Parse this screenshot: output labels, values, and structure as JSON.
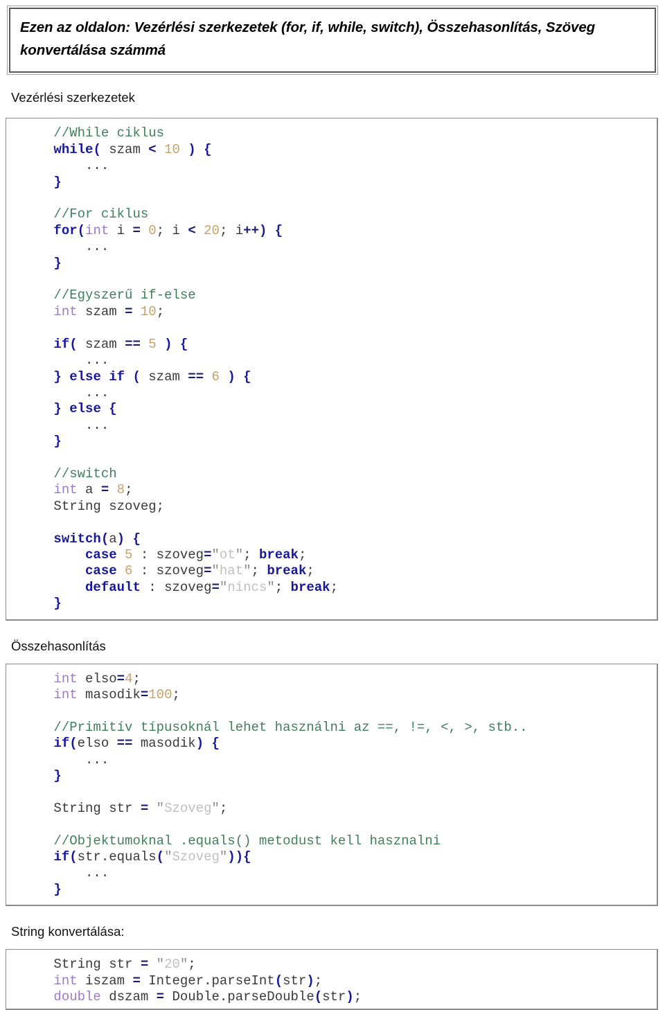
{
  "document": {
    "header_box": {
      "text": "Ezen az oldalon: Vezérlési szerkezetek (for, if, while, switch), Összehasonlítás, Szöveg konvertálása számmá"
    },
    "sections": [
      {
        "heading": "Vezérlési szerkezetek",
        "code_lines": [
          "//While ciklus",
          "while( szam < 10 ) {",
          "    ...",
          "}",
          "",
          "//For ciklus",
          "for(int i = 0; i < 20; i++) {",
          "    ...",
          "}",
          "",
          "//Egyszerű if-else",
          "int szam = 10;",
          "",
          "if( szam == 5 ) {",
          "    ...",
          "} else if ( szam == 6 ) {",
          "    ...",
          "} else {",
          "    ...",
          "}",
          "",
          "//switch",
          "int a = 8;",
          "String szoveg;",
          "",
          "switch(a) {",
          "    case 5 : szoveg=\"ot\"; break;",
          "    case 6 : szoveg=\"hat\"; break;",
          "    default : szoveg=\"nincs\"; break;",
          "}"
        ]
      },
      {
        "heading": "Összehasonlítás",
        "code_lines": [
          "int elso=4;",
          "int masodik=100;",
          "",
          "//Primitív típusoknál lehet használni az ==, !=, <, >, stb..",
          "if(elso == masodik) {",
          "    ...",
          "}",
          "",
          "String str = \"Szoveg\";",
          "",
          "//Objektumoknal .equals() metodust kell hasznalni",
          "if(str.equals(\"Szoveg\")){",
          "    ...",
          "}"
        ]
      },
      {
        "heading": "String konvertálása:",
        "code_lines": [
          "String str = \"20\";",
          "int iszam = Integer.parseInt(str);",
          "double dszam = Double.parseDouble(str);"
        ]
      }
    ],
    "colors": {
      "comment": "#3f7f5f",
      "keyword": "#18189c",
      "type": "#9f78c8",
      "number": "#c7a06a",
      "string": "#bfbfbf",
      "text": "#3a3a3a",
      "box_border": "#8a8a8a",
      "header_border": "#595959"
    }
  }
}
